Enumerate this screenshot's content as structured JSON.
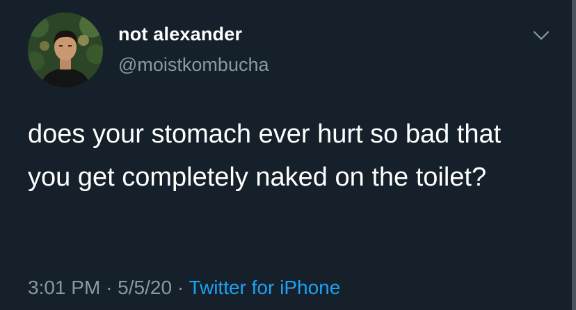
{
  "user": {
    "display_name": "not alexander",
    "handle": "@moistkombucha"
  },
  "tweet": {
    "text": "does your stomach ever hurt so bad that you get completely naked on the toilet?",
    "time": "3:01 PM",
    "separator": "·",
    "date": "5/5/20",
    "source": "Twitter for iPhone"
  },
  "icons": {
    "more": "chevron-down-icon"
  },
  "colors": {
    "background": "#15202b",
    "primary_text": "#ffffff",
    "secondary_text": "#8899a6",
    "link": "#1da1f2"
  }
}
